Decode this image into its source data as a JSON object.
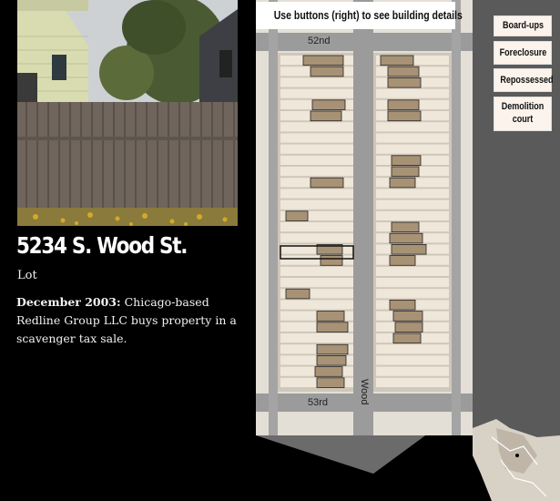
{
  "property": {
    "address": "5234 S. Wood St.",
    "type": "Lot",
    "event_date": "December 2003:",
    "event_text": "Chicago-based Redline Group LLC buys property in a scavenger tax sale."
  },
  "map": {
    "instruction": "Use buttons (right) to see building details",
    "streets": {
      "north": "52nd",
      "south": "53rd",
      "east": "Wood"
    }
  },
  "buttons": [
    {
      "label": "Board-ups"
    },
    {
      "label": "Foreclosure"
    },
    {
      "label": "Repossessed"
    },
    {
      "label": "Demolition court"
    }
  ],
  "colors": {
    "background": "#000000",
    "street": "#9a9a9a",
    "block": "#e6e1d9",
    "lot": "#efe7da",
    "building": "#a89275",
    "button_bg": "#fbf3ec"
  }
}
